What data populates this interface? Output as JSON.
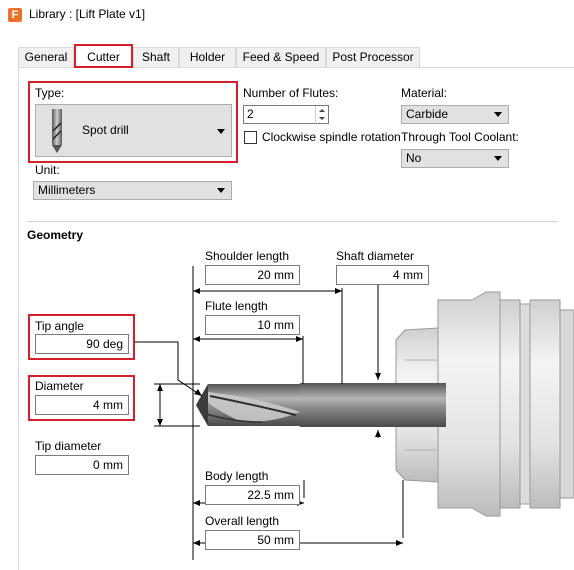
{
  "window": {
    "title": "Library : [Lift Plate v1]",
    "icon": "F"
  },
  "tabs": [
    {
      "label": "General",
      "active": false
    },
    {
      "label": "Cutter",
      "active": true
    },
    {
      "label": "Shaft",
      "active": false
    },
    {
      "label": "Holder",
      "active": false
    },
    {
      "label": "Feed & Speed",
      "active": false
    },
    {
      "label": "Post Processor",
      "active": false
    }
  ],
  "cutter": {
    "type_label": "Type:",
    "type_value": "Spot drill",
    "flutes_label": "Number of Flutes:",
    "flutes_value": "2",
    "clockwise_label": "Clockwise spindle rotation",
    "clockwise_checked": false,
    "material_label": "Material:",
    "material_value": "Carbide",
    "coolant_label": "Through Tool Coolant:",
    "coolant_value": "No",
    "unit_label": "Unit:",
    "unit_value": "Millimeters"
  },
  "geometry": {
    "heading": "Geometry",
    "shoulder_length_label": "Shoulder length",
    "shoulder_length_value": "20 mm",
    "shaft_diameter_label": "Shaft diameter",
    "shaft_diameter_value": "4 mm",
    "flute_length_label": "Flute length",
    "flute_length_value": "10 mm",
    "tip_angle_label": "Tip angle",
    "tip_angle_value": "90 deg",
    "diameter_label": "Diameter",
    "diameter_value": "4 mm",
    "tip_diameter_label": "Tip diameter",
    "tip_diameter_value": "0 mm",
    "body_length_label": "Body length",
    "body_length_value": "22.5 mm",
    "overall_length_label": "Overall length",
    "overall_length_value": "50 mm"
  },
  "colors": {
    "highlight": "#d4202c",
    "accent": "#e8742c"
  }
}
